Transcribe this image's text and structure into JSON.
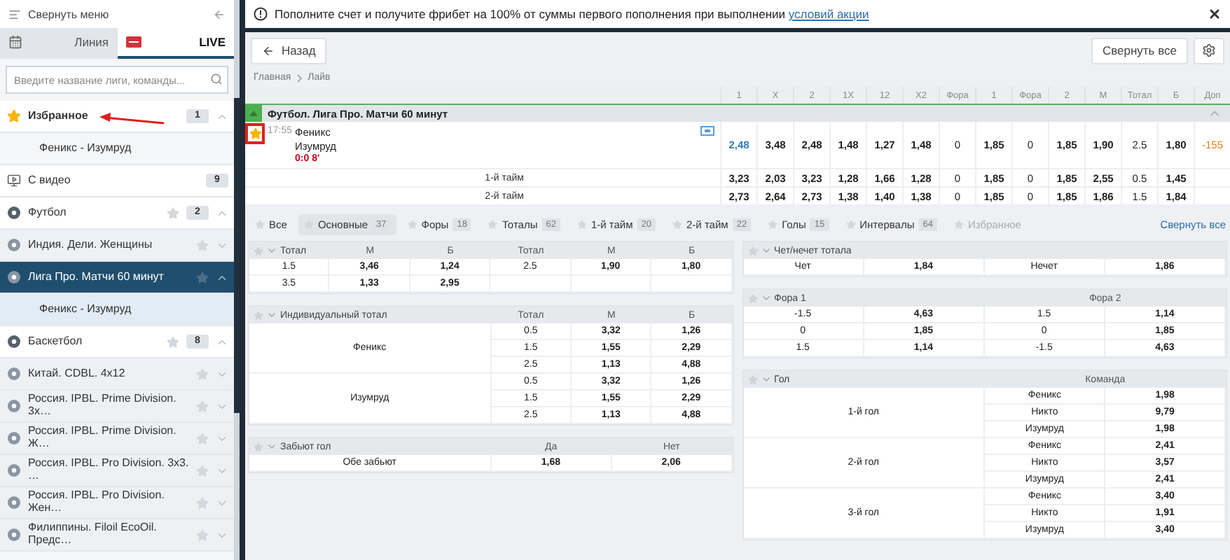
{
  "sidebar": {
    "collapse_label": "Свернуть меню",
    "tabs": [
      {
        "label": "Линия",
        "kind": "line",
        "selected": false
      },
      {
        "label": "LIVE",
        "kind": "live",
        "selected": true
      }
    ],
    "search": {
      "placeholder": "Введите название лиги, команды..."
    },
    "items": [
      {
        "kind": "favorites",
        "label": "Избранное",
        "count": "1",
        "expanded": true,
        "selected": false,
        "children": [
          {
            "kind": "event",
            "label": "Феникс - Изумруд",
            "selected": false
          }
        ]
      },
      {
        "kind": "video",
        "label": "С видео",
        "count": "9",
        "selected": false
      },
      {
        "kind": "sport",
        "label": "Футбол",
        "count": "2",
        "expanded": true,
        "selected": false,
        "children": [
          {
            "kind": "league",
            "label": "Индия. Дели. Женщины",
            "expanded": false,
            "selected": false
          },
          {
            "kind": "league",
            "label": "Лига Про. Матчи 60 минут",
            "expanded": true,
            "selected": true,
            "children": [
              {
                "kind": "event",
                "label": "Феникс - Изумруд",
                "selected": false
              }
            ]
          }
        ]
      },
      {
        "kind": "sport",
        "label": "Баскетбол",
        "count": "8",
        "expanded": true,
        "selected": false,
        "children": [
          {
            "kind": "league",
            "label": "Китай. CDBL. 4x12",
            "expanded": false,
            "selected": false
          },
          {
            "kind": "league",
            "label": "Россия. IPBL. Prime Division. 3х…",
            "expanded": false,
            "selected": false
          },
          {
            "kind": "league",
            "label": "Россия. IPBL. Prime Division. Ж…",
            "expanded": false,
            "selected": false
          },
          {
            "kind": "league",
            "label": "Россия. IPBL. Pro Division. 3х3. …",
            "expanded": false,
            "selected": false
          },
          {
            "kind": "league",
            "label": "Россия. IPBL. Pro Division. Жен…",
            "expanded": false,
            "selected": false
          },
          {
            "kind": "league",
            "label": "Филиппины. Filoil EcoOil. Предс…",
            "expanded": false,
            "selected": false
          }
        ]
      }
    ]
  },
  "notice": {
    "text": "Пополните счет и получите фрибет на 100% от суммы первого пополнения при выполнении",
    "link": "условий акции"
  },
  "toolbar": {
    "back": "Назад",
    "collapse_all": "Свернуть все"
  },
  "breadcrumbs": [
    "Главная",
    "Лайв"
  ],
  "odds_columns": [
    {
      "label": "1",
      "kind": "odd"
    },
    {
      "label": "X",
      "kind": "odd"
    },
    {
      "label": "2",
      "kind": "odd"
    },
    {
      "label": "1X",
      "kind": "odd"
    },
    {
      "label": "12",
      "kind": "odd"
    },
    {
      "label": "X2",
      "kind": "odd"
    },
    {
      "label": "Фора",
      "kind": "param"
    },
    {
      "label": "1",
      "kind": "odd"
    },
    {
      "label": "Фора",
      "kind": "param"
    },
    {
      "label": "2",
      "kind": "odd"
    },
    {
      "label": "М",
      "kind": "odd"
    },
    {
      "label": "Тотал",
      "kind": "param"
    },
    {
      "label": "Б",
      "kind": "odd"
    },
    {
      "label": "Доп",
      "kind": "extra"
    }
  ],
  "league": {
    "title": "Футбол. Лига Про. Матчи 60 минут",
    "expanded": true
  },
  "match": {
    "favorite": true,
    "time": "17:55",
    "team1": "Феникс",
    "team2": "Изумруд",
    "score": "0:0 8'",
    "odds": [
      {
        "value": "2,48",
        "rising": true
      },
      {
        "value": "3,48",
        "rising": false
      },
      {
        "value": "2,48",
        "rising": false
      },
      {
        "value": "1,48",
        "rising": false
      },
      {
        "value": "1,27",
        "rising": false
      },
      {
        "value": "1,48",
        "rising": false
      },
      {
        "value": "0",
        "rising": false
      },
      {
        "value": "1,85",
        "rising": false
      },
      {
        "value": "0",
        "rising": false
      },
      {
        "value": "1,85",
        "rising": false
      },
      {
        "value": "1,90",
        "rising": false
      },
      {
        "value": "2.5",
        "rising": false
      },
      {
        "value": "1,80",
        "rising": false
      },
      {
        "value": "-155",
        "rising": false
      }
    ],
    "periods": [
      {
        "label": "1-й тайм",
        "odds": [
          "3,23",
          "2,03",
          "3,23",
          "1,28",
          "1,66",
          "1,28",
          "0",
          "1,85",
          "0",
          "1,85",
          "2,55",
          "0.5",
          "1,45"
        ]
      },
      {
        "label": "2-й тайм",
        "odds": [
          "2,73",
          "2,64",
          "2,73",
          "1,38",
          "1,40",
          "1,38",
          "0",
          "1,85",
          "0",
          "1,85",
          "1,86",
          "1.5",
          "1,84"
        ]
      }
    ]
  },
  "filters": [
    {
      "label": "Все",
      "selected": false,
      "disabled": false
    },
    {
      "label": "Основные",
      "count": "37",
      "selected": true,
      "disabled": false
    },
    {
      "label": "Форы",
      "count": "18",
      "selected": false,
      "disabled": false
    },
    {
      "label": "Тоталы",
      "count": "62",
      "selected": false,
      "disabled": false
    },
    {
      "label": "1-й тайм",
      "count": "20",
      "selected": false,
      "disabled": false
    },
    {
      "label": "2-й тайм",
      "count": "22",
      "selected": false,
      "disabled": false
    },
    {
      "label": "Голы",
      "count": "15",
      "selected": false,
      "disabled": false
    },
    {
      "label": "Интервалы",
      "count": "64",
      "selected": false,
      "disabled": false
    },
    {
      "label": "Избранное",
      "selected": false,
      "disabled": true
    }
  ],
  "collapse_all_link": "Свернуть все",
  "markets": [
    [
      {
        "kind": "table",
        "title": "Тотал",
        "columns": [
          {
            "kind": "param"
          },
          {
            "label": "М",
            "kind": "odd"
          },
          {
            "label": "Б",
            "kind": "odd"
          },
          {
            "label": "Тотал",
            "kind": "param"
          },
          {
            "label": "М",
            "kind": "odd"
          },
          {
            "label": "Б",
            "kind": "odd"
          }
        ],
        "rows": [
          [
            "1.5",
            "3,46",
            "1,24",
            "2.5",
            "1,90",
            "1,80"
          ],
          [
            "3.5",
            "1,33",
            "2,95",
            null,
            null,
            null
          ]
        ]
      },
      {
        "kind": "grouped",
        "title": "Индивидуальный тотал",
        "columns": [
          {
            "label": "Тотал",
            "kind": "param"
          },
          {
            "label": "М",
            "kind": "odd"
          },
          {
            "label": "Б",
            "kind": "odd"
          }
        ],
        "groups": [
          {
            "name": "Феникс",
            "rows": [
              [
                "0.5",
                "3,32",
                "1,26"
              ],
              [
                "1.5",
                "1,55",
                "2,29"
              ],
              [
                "2.5",
                "1,13",
                "4,88"
              ]
            ]
          },
          {
            "name": "Изумруд",
            "rows": [
              [
                "0.5",
                "3,32",
                "1,26"
              ],
              [
                "1.5",
                "1,55",
                "2,29"
              ],
              [
                "2.5",
                "1,13",
                "4,88"
              ]
            ]
          }
        ]
      },
      {
        "kind": "grouped",
        "title": "Забьют гол",
        "columns": [
          {
            "label": "Да",
            "kind": "odd"
          },
          {
            "label": "Нет",
            "kind": "odd"
          }
        ],
        "groups": [
          {
            "name": "Обе забьют",
            "rows": [
              [
                "1,68",
                "2,06"
              ]
            ]
          }
        ]
      }
    ],
    [
      {
        "kind": "table",
        "title": "Чет/нечет тотала",
        "columns": [
          {
            "kind": "param"
          },
          {
            "kind": "odd"
          },
          {
            "kind": "param"
          },
          {
            "kind": "odd"
          }
        ],
        "rows": [
          [
            "Чет",
            "1,84",
            "Нечет",
            "1,86"
          ]
        ]
      },
      {
        "kind": "table",
        "title": "Фора 1",
        "columns": [
          {
            "kind": "param"
          },
          {
            "kind": "odd"
          },
          {
            "label": "Фора 2",
            "kind": "param"
          },
          {
            "kind": "odd"
          }
        ],
        "rows": [
          [
            "-1.5",
            "4,63",
            "1.5",
            "1,14"
          ],
          [
            "0",
            "1,85",
            "0",
            "1,85"
          ],
          [
            "1.5",
            "1,14",
            "-1.5",
            "4,63"
          ]
        ]
      },
      {
        "kind": "grouped",
        "title": "Гол",
        "columns": [
          {
            "label": "Команда",
            "kind": "param"
          },
          {
            "kind": "odd"
          }
        ],
        "groups": [
          {
            "name": "1-й гол",
            "rows": [
              [
                "Феникс",
                "1,98"
              ],
              [
                "Никто",
                "9,79"
              ],
              [
                "Изумруд",
                "1,98"
              ]
            ]
          },
          {
            "name": "2-й гол",
            "rows": [
              [
                "Феникс",
                "2,41"
              ],
              [
                "Никто",
                "3,57"
              ],
              [
                "Изумруд",
                "2,41"
              ]
            ]
          },
          {
            "name": "3-й гол",
            "rows": [
              [
                "Феникс",
                "3,40"
              ],
              [
                "Никто",
                "1,91"
              ],
              [
                "Изумруд",
                "3,40"
              ]
            ]
          }
        ]
      }
    ]
  ]
}
